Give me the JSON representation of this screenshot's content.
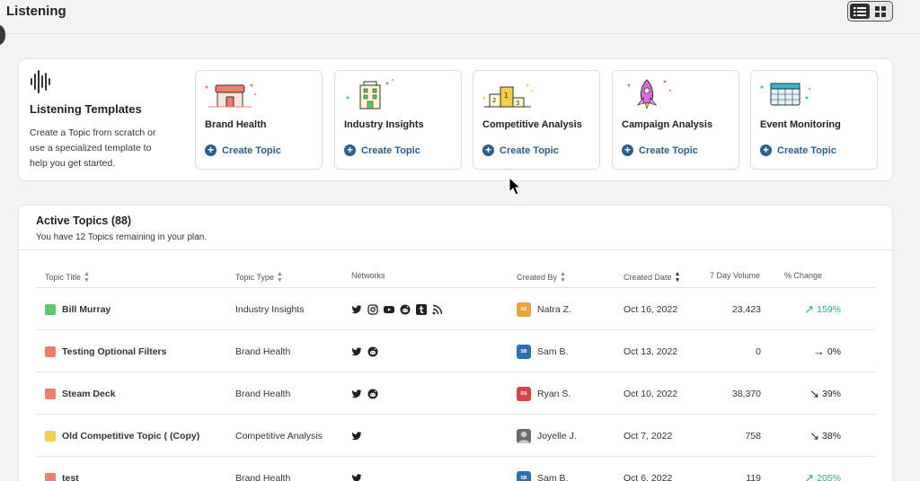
{
  "header": {
    "title": "Listening"
  },
  "view_toggle": {
    "active": "list-view",
    "icons": [
      "list-view-icon",
      "grid-view-icon"
    ]
  },
  "templates": {
    "title": "Listening Templates",
    "description": "Create a Topic from scratch or use a specialized template to help you get started.",
    "icon": "sound-wave-icon",
    "items": [
      {
        "name": "Brand Health",
        "cta": "Create Topic",
        "icon": "storefront-icon"
      },
      {
        "name": "Industry Insights",
        "cta": "Create Topic",
        "icon": "building-icon"
      },
      {
        "name": "Competitive Analysis",
        "cta": "Create Topic",
        "icon": "podium-icon"
      },
      {
        "name": "Campaign Analysis",
        "cta": "Create Topic",
        "icon": "rocket-icon"
      },
      {
        "name": "Event Monitoring",
        "cta": "Create Topic",
        "icon": "calendar-icon"
      }
    ]
  },
  "topics": {
    "title": "Active Topics",
    "count": "(88)",
    "subtitle": "You have 12 Topics remaining in your plan.",
    "columns": {
      "title": "Topic Title",
      "type": "Topic Type",
      "networks": "Networks",
      "created_by": "Created By",
      "created_date": "Created Date",
      "volume": "7 Day Volume",
      "change": "% Change"
    },
    "rows": [
      {
        "title": "Bill Murray",
        "color": "#5fc66a",
        "type": "Industry Insights",
        "networks": [
          "twitter",
          "instagram",
          "youtube",
          "reddit",
          "tumblr",
          "rss"
        ],
        "creator": "Natra Z.",
        "initials": "NZ",
        "avatar_color": "#e8a33c",
        "date": "Oct 16, 2022",
        "volume": "23,423",
        "change": "159%",
        "trend": "up"
      },
      {
        "title": "Testing Optional Filters",
        "color": "#ef7d6e",
        "type": "Brand Health",
        "networks": [
          "twitter",
          "reddit"
        ],
        "creator": "Sam B.",
        "initials": "SB",
        "avatar_color": "#2f6fb7",
        "date": "Oct 13, 2022",
        "volume": "0",
        "change": "0%",
        "trend": "flat"
      },
      {
        "title": "Steam Deck",
        "color": "#ef7d6e",
        "type": "Brand Health",
        "networks": [
          "twitter",
          "reddit"
        ],
        "creator": "Ryan S.",
        "initials": "RS",
        "avatar_color": "#d64545",
        "date": "Oct 10, 2022",
        "volume": "38,370",
        "change": "39%",
        "trend": "down"
      },
      {
        "title": "Old Competitive Topic ( (Copy)",
        "color": "#f5cf48",
        "type": "Competitive Analysis",
        "networks": [
          "twitter"
        ],
        "creator": "Joyelle J.",
        "initials": "",
        "avatar_color": "#6b6b6b",
        "date": "Oct 7, 2022",
        "volume": "758",
        "change": "38%",
        "trend": "down"
      },
      {
        "title": "test",
        "color": "#ef7d6e",
        "type": "Brand Health",
        "networks": [
          "twitter"
        ],
        "creator": "Sam B.",
        "initials": "SB",
        "avatar_color": "#2f6fb7",
        "date": "Oct 6, 2022",
        "volume": "119",
        "change": "205%",
        "trend": "up"
      }
    ]
  },
  "colors": {
    "accent": "#275e8f",
    "trend_up": "#27a6a0",
    "trend_neutral": "#222222"
  }
}
